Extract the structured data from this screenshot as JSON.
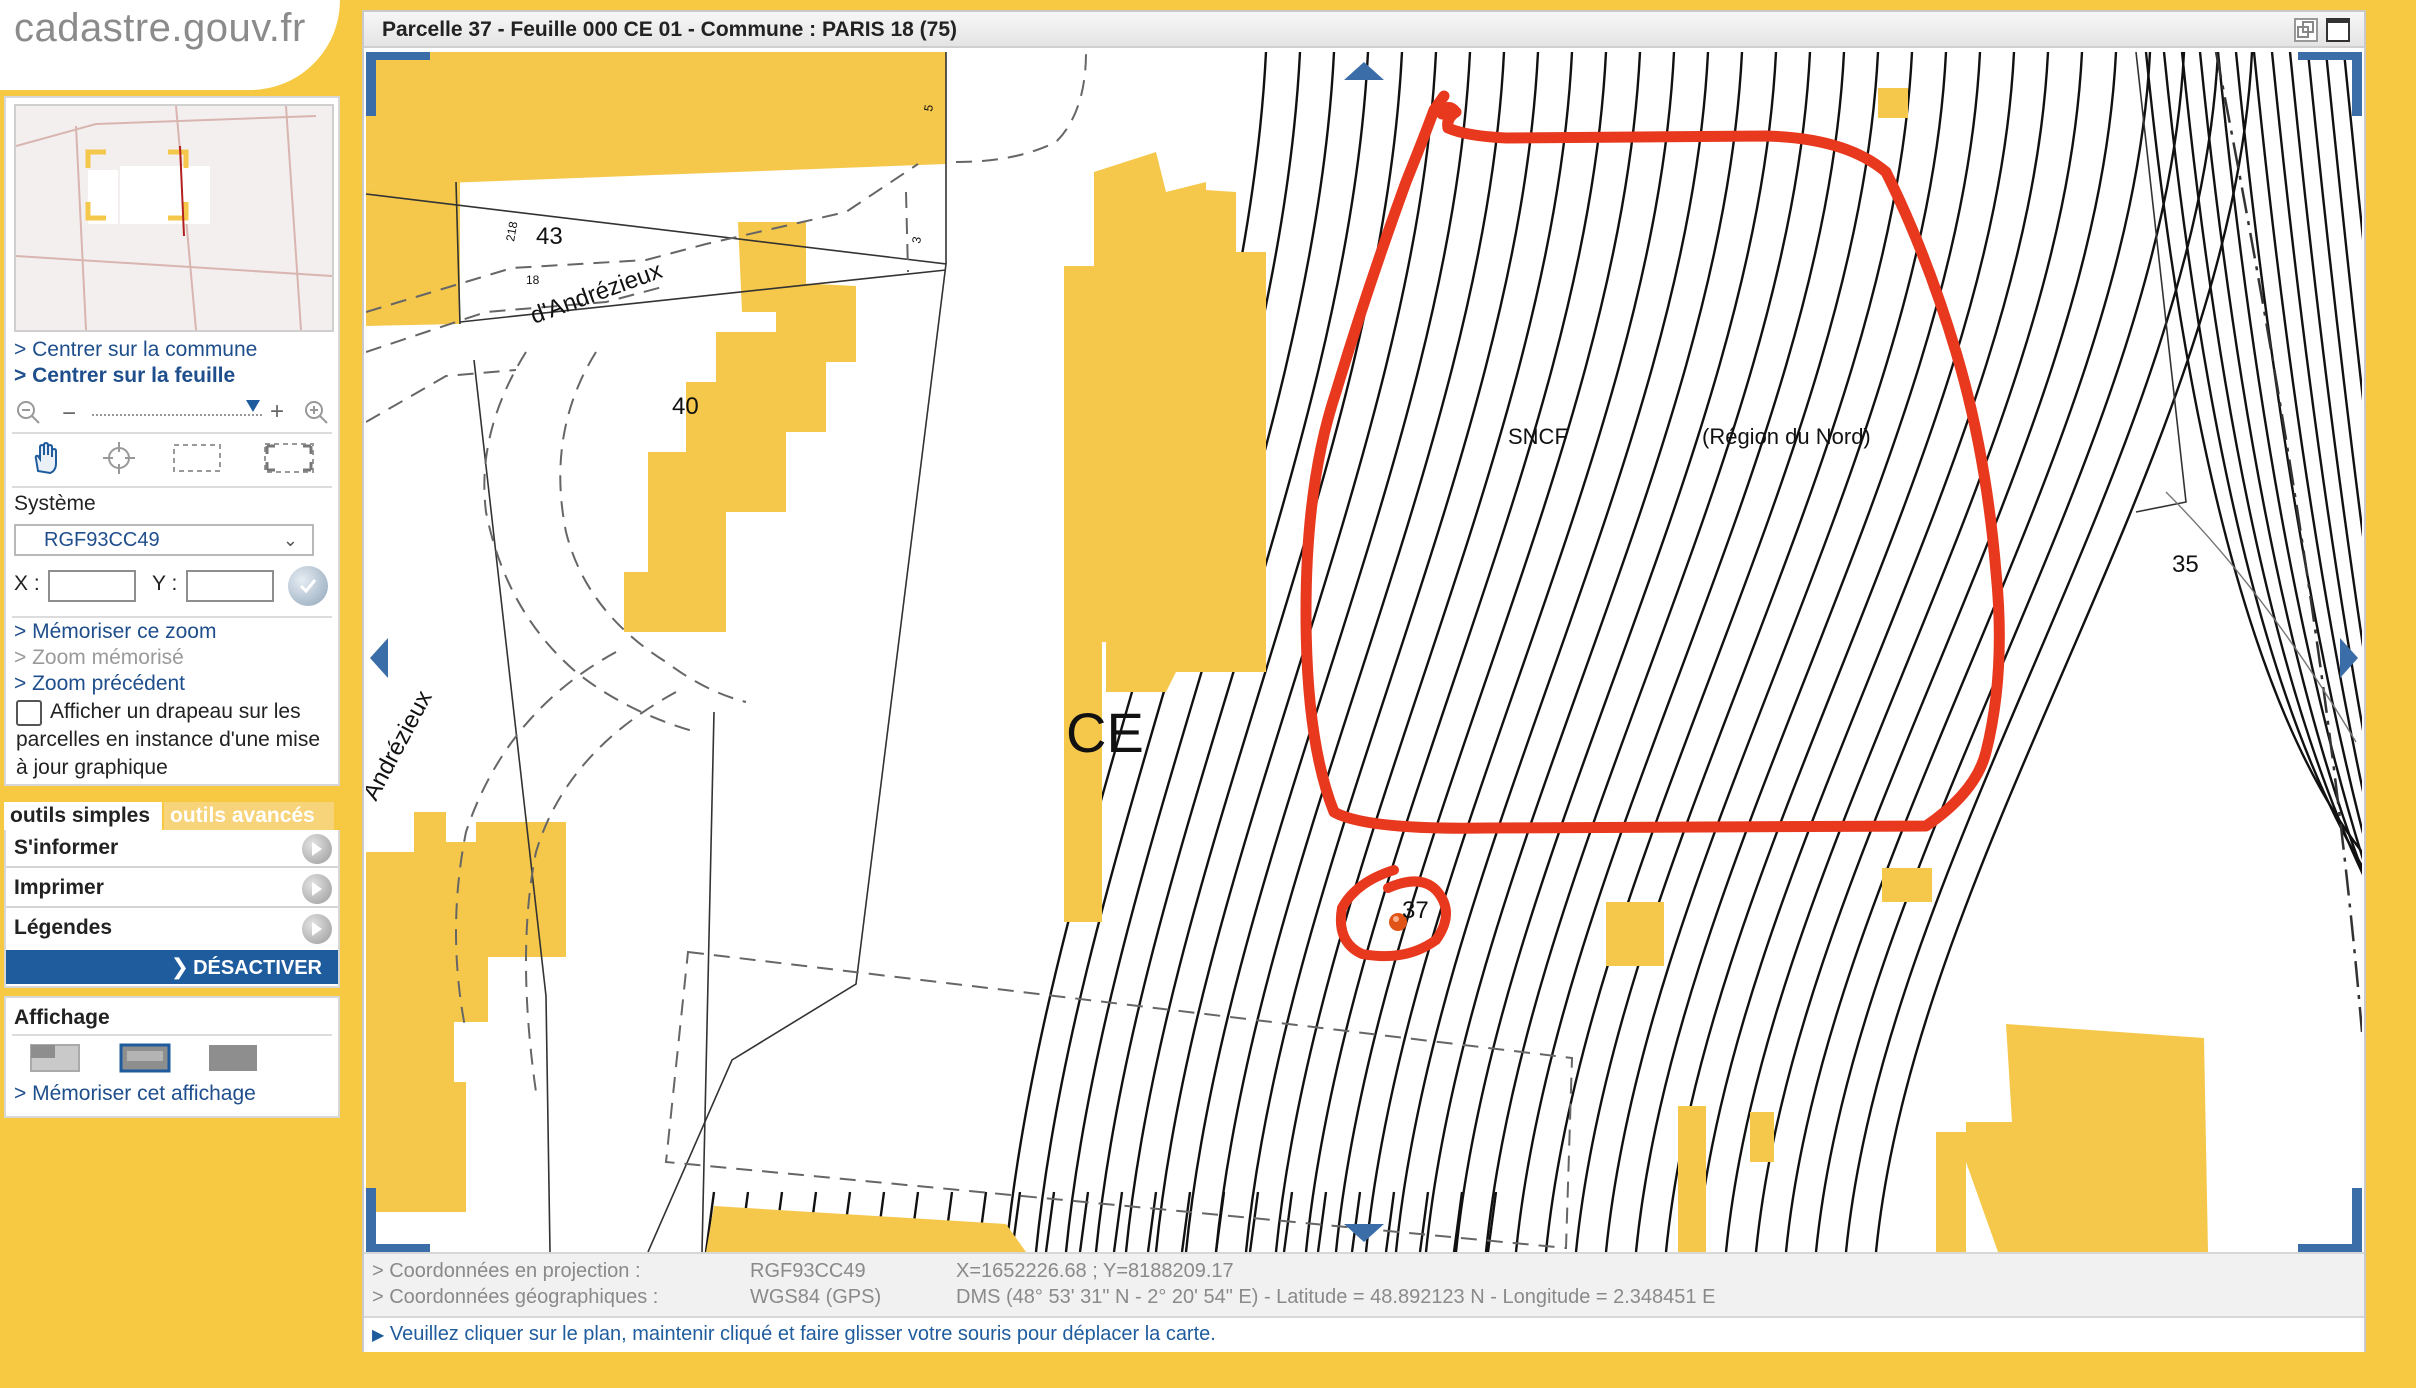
{
  "logo": {
    "text": "cadastre.gouv.fr"
  },
  "window": {
    "title": "Parcelle 37 - Feuille 000 CE 01 - Commune : PARIS 18 (75)"
  },
  "nav": {
    "center_commune": "> Centrer sur la commune",
    "center_sheet": "> Centrer sur la feuille",
    "system_label": "Système",
    "system_value": "RGF93CC49",
    "x_label": "X :",
    "y_label": "Y :",
    "memorize_zoom": "> Mémoriser ce zoom",
    "memorized_zoom": "> Zoom mémorisé",
    "previous_zoom": "> Zoom précédent",
    "flag_line1": "Afficher un drapeau sur les",
    "flag_line2": "parcelles en instance d'une mise",
    "flag_line3": "à jour graphique"
  },
  "tabs": {
    "simple": "outils simples",
    "advanced": "outils avancés"
  },
  "tools": {
    "inform": "S'informer",
    "print": "Imprimer",
    "legends": "Légendes",
    "deactivate": "DÉSACTIVER"
  },
  "display": {
    "title": "Affichage",
    "memorize": "> Mémoriser cet affichage"
  },
  "map_labels": {
    "section": "CE",
    "parcel_43": "43",
    "parcel_40": "40",
    "parcel_35": "35",
    "parcel_37": "37",
    "street_top": "d'Andrézieux",
    "street_left": "Andrézieux",
    "owner": "SNCF",
    "region": "(Région du Nord)",
    "small_218": "218",
    "small_18": "18",
    "small_5": "5",
    "small_3": "3"
  },
  "status": {
    "proj_label": "> Coordonnées en projection :",
    "proj_system": "RGF93CC49",
    "proj_value": "X=1652226.68 ; Y=8188209.17",
    "geo_label": "> Coordonnées géographiques :",
    "geo_system": "WGS84 (GPS)",
    "geo_value": "DMS (48° 53' 31\" N - 2° 20' 54\" E) - Latitude = 48.892123 N - Longitude = 2.348451 E"
  },
  "hint": "Veuillez cliquer sur le plan, maintenir cliqué et faire glisser votre souris pour déplacer la carte.",
  "colors": {
    "background": "#F7C943",
    "building": "#F5C84C",
    "link": "#1F4E8C",
    "annotation": "#E8391E"
  }
}
